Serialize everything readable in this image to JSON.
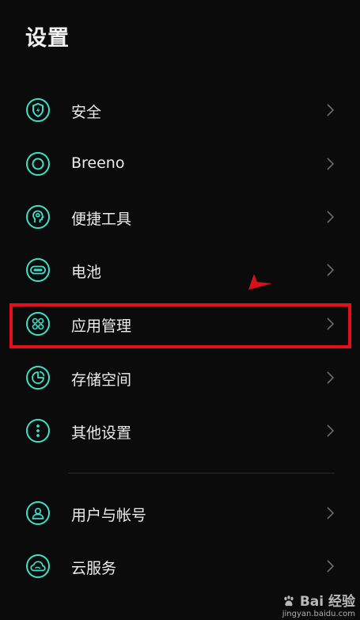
{
  "header": {
    "title": "设置"
  },
  "settings_list": {
    "items": [
      {
        "label": "安全",
        "icon": "security-shield-icon"
      },
      {
        "label": "Breeno",
        "icon": "breeno-ring-icon"
      },
      {
        "label": "便捷工具",
        "icon": "convenience-tools-icon"
      },
      {
        "label": "电池",
        "icon": "battery-icon"
      },
      {
        "label": "应用管理",
        "icon": "app-management-icon"
      },
      {
        "label": "存储空间",
        "icon": "storage-pie-icon"
      },
      {
        "label": "其他设置",
        "icon": "more-dots-icon"
      },
      {
        "label": "用户与帐号",
        "icon": "user-account-icon"
      },
      {
        "label": "云服务",
        "icon": "cloud-icon"
      }
    ]
  },
  "watermark": {
    "logo": "Bai 经验",
    "url": "jingyan.baidu.com"
  },
  "colors": {
    "background": "#0b0b0b",
    "icon_accent": "#3fe0c8",
    "highlight": "#e3101a"
  }
}
